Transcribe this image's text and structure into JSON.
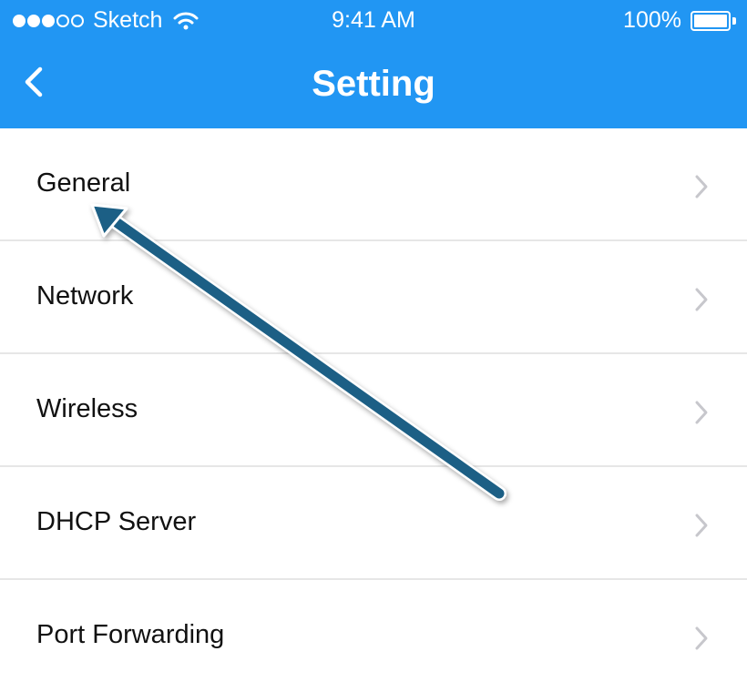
{
  "status_bar": {
    "carrier": "Sketch",
    "time": "9:41 AM",
    "battery": "100%",
    "signal_icon": "signal-dots-icon",
    "wifi_icon": "wifi-icon",
    "battery_icon": "battery-icon"
  },
  "nav": {
    "title": "Setting",
    "back_icon": "chevron-left-icon"
  },
  "settings": [
    {
      "label": "General",
      "icon": "chevron-right-icon"
    },
    {
      "label": "Network",
      "icon": "chevron-right-icon"
    },
    {
      "label": "Wireless",
      "icon": "chevron-right-icon"
    },
    {
      "label": "DHCP Server",
      "icon": "chevron-right-icon"
    },
    {
      "label": "Port Forwarding",
      "icon": "chevron-right-icon"
    }
  ],
  "annotation": {
    "arrow_color": "#1a5f85",
    "points_to": "General"
  },
  "colors": {
    "accent": "#2196f3",
    "divider": "#e6e6e6"
  }
}
